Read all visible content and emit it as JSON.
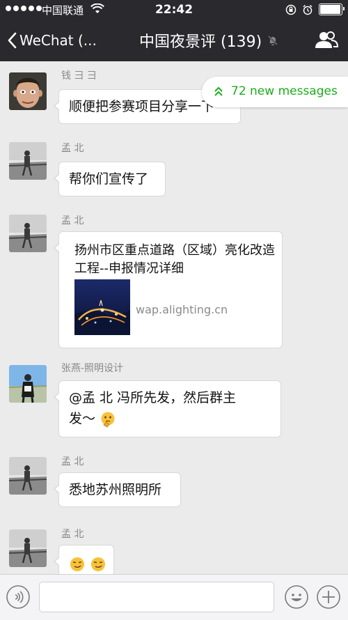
{
  "status_bar": {
    "carrier": "中国联通",
    "time": "22:42",
    "battery_level": 0.95
  },
  "nav": {
    "back_label": "WeChat (...",
    "title": "中国夜景评 (139)"
  },
  "new_messages": {
    "label": "72 new messages"
  },
  "messages": [
    {
      "sender": "钱 彐 彐",
      "text": "顺便把参赛项目分享一下"
    },
    {
      "sender": "孟  北",
      "text": "帮你们宣传了"
    },
    {
      "sender": "孟  北",
      "link": {
        "title": "扬州市区重点道路（区域）亮化改造工程--申报情况详细",
        "domain": "wap.alighting.cn"
      }
    },
    {
      "sender": "张燕-照明设计",
      "text_line1": "@孟  北 冯所先发，然后群主",
      "text_line2": "发～"
    },
    {
      "sender": "孟  北",
      "text": "悉地苏州照明所"
    },
    {
      "sender": "孟  北",
      "text": ""
    }
  ],
  "input": {
    "value": "",
    "placeholder": ""
  },
  "colors": {
    "accent_green": "#1aad19",
    "nav_bg": "#2a2a2e",
    "chat_bg": "#ebebeb"
  },
  "icons": {
    "back": "chevron-left-icon",
    "mute": "mute-bell-icon",
    "group": "group-members-icon",
    "voice": "voice-icon",
    "emoji": "emoji-icon",
    "more": "plus-icon",
    "new_messages": "double-chevron-up-icon"
  }
}
